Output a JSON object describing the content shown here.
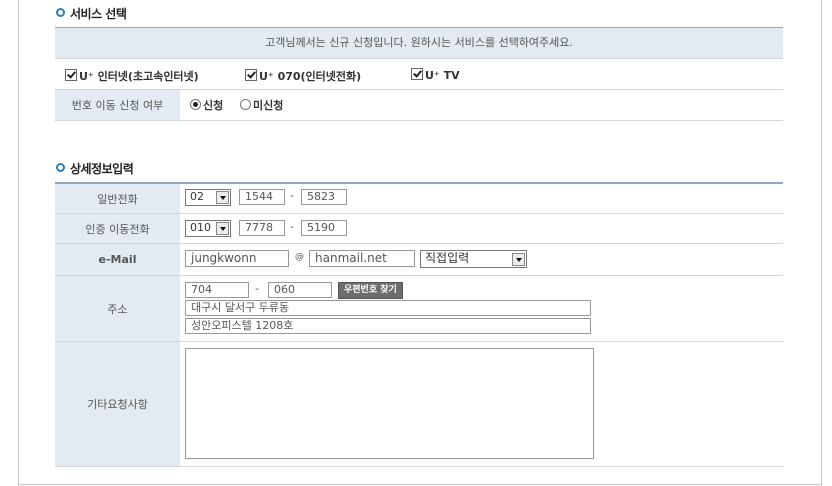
{
  "service": {
    "title": "서비스 선택",
    "notice": "고객님께서는 신규 신청입니다. 원하시는 서비스를 선택하여주세요.",
    "options": [
      {
        "label": "U⁺ 인터넷(초고속인터넷)",
        "checked": true
      },
      {
        "label": "U⁺ 070(인터넷전화)",
        "checked": true
      },
      {
        "label": "U⁺ TV",
        "checked": true
      }
    ],
    "number_transfer": {
      "label": "번호 이동 신청 여부",
      "opt_apply": "신청",
      "opt_no": "미신청",
      "selected": "신청"
    }
  },
  "detail": {
    "title": "상세정보입력",
    "phone": {
      "label": "일반전화",
      "area": "02",
      "mid": "1544",
      "last": "5823"
    },
    "mobile": {
      "label": "인증 이동전화",
      "prefix": "010",
      "mid": "7778",
      "last": "5190"
    },
    "email": {
      "label": "e-Mail",
      "user": "jungkwonn",
      "at": "@",
      "domain": "hanmail.net",
      "select": "직접입력"
    },
    "address": {
      "label": "주소",
      "zip1": "704",
      "zip2": "060",
      "zip_button": "우편번호 찾기",
      "line1": "대구시 달서구 두류동",
      "line2": "성안오피스텔 1208호"
    },
    "request": {
      "label": "기타요청사항",
      "value": ""
    },
    "separator": "-"
  }
}
